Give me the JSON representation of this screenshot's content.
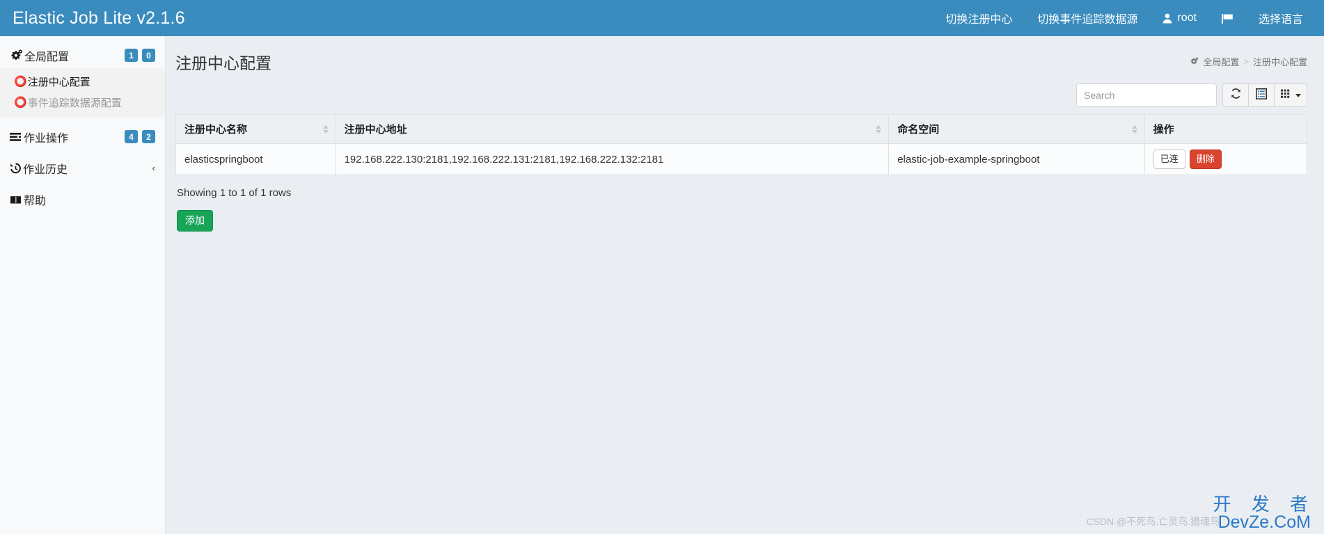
{
  "navbar": {
    "brand": "Elastic Job Lite v2.1.6",
    "items": [
      {
        "label": "切换注册中心",
        "icon": ""
      },
      {
        "label": "切换事件追踪数据源",
        "icon": ""
      },
      {
        "label": "root",
        "icon": "user-icon"
      },
      {
        "label": "",
        "icon": "flag-icon"
      },
      {
        "label": "选择语言",
        "icon": ""
      }
    ]
  },
  "sidebar": {
    "global_config": {
      "label": "全局配置",
      "icon": "gears-icon",
      "badges": [
        "1",
        "0"
      ]
    },
    "submenu": [
      {
        "label": "注册中心配置",
        "state": "active"
      },
      {
        "label": "事件追踪数据源配置",
        "state": "muted"
      }
    ],
    "job_operation": {
      "label": "作业操作",
      "icon": "tasks-icon",
      "badges": [
        "4",
        "2"
      ]
    },
    "job_history": {
      "label": "作业历史",
      "icon": "history-icon",
      "chevron": "‹"
    },
    "help": {
      "label": "帮助",
      "icon": "book-icon"
    }
  },
  "page": {
    "title": "注册中心配置",
    "breadcrumb": {
      "root": "全局配置",
      "root_icon": "gears-icon",
      "separator": ">",
      "current": "注册中心配置"
    }
  },
  "toolbar": {
    "search_placeholder": "Search",
    "search_value": "",
    "refresh_icon": "refresh-icon",
    "toggle_icon": "list-view-icon",
    "columns_icon": "columns-grid-icon"
  },
  "table": {
    "columns": [
      {
        "label": "注册中心名称",
        "sortable": true
      },
      {
        "label": "注册中心地址",
        "sortable": false
      },
      {
        "label": "命名空间",
        "sortable": true
      },
      {
        "label": "操作",
        "sortable": false
      }
    ],
    "rows": [
      {
        "name": "elasticspringboot",
        "address": "192.168.222.130:2181,192.168.222.131:2181,192.168.222.132:2181",
        "namespace": "elastic-job-example-springboot",
        "actions": [
          {
            "label": "已连",
            "style": "default"
          },
          {
            "label": "删除",
            "style": "danger"
          }
        ]
      }
    ],
    "rows_info": "Showing 1 to 1 of 1 rows"
  },
  "actions": {
    "add_label": "添加"
  },
  "watermarks": {
    "csdn": "CSDN @不死鸟.亡灵鸟.猎魂鸟",
    "devze_cn": "开 发 者",
    "devze_en": "DevZe.CoM"
  },
  "colors": {
    "navbar": "#3a8cbe",
    "badge": "#3a8cbe",
    "danger": "#d9442f",
    "success": "#18a558",
    "page_bg": "#eaeef2",
    "sidebar_bg": "#f7f9fa"
  }
}
